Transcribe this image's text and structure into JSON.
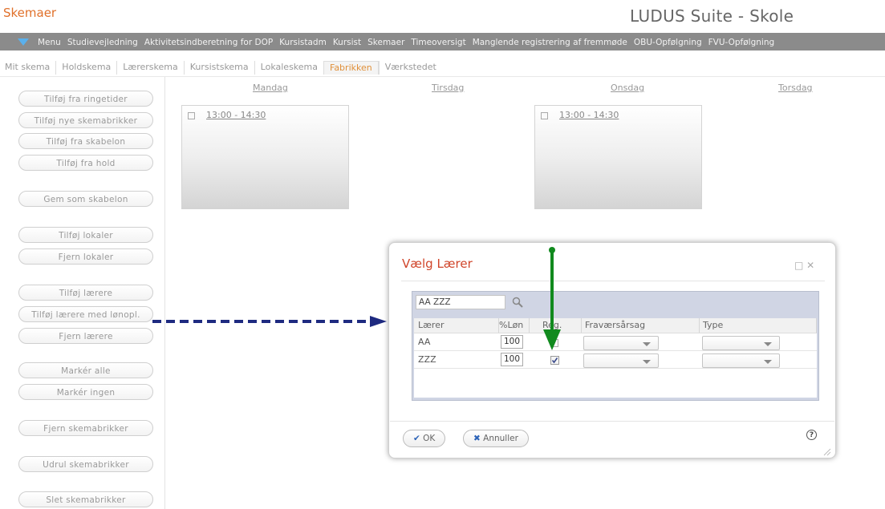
{
  "app": {
    "page_title": "Skemaer",
    "suite_title": "LUDUS Suite - Skole"
  },
  "menu": {
    "items": [
      "Menu",
      "Studievejledning",
      "Aktivitetsindberetning for DOP",
      "Kursistadm",
      "Kursist",
      "Skemaer",
      "Timeoversigt",
      "Manglende registrering af fremmøde",
      "OBU-Opfølgning",
      "FVU-Opfølgning"
    ]
  },
  "tabs": [
    "Mit skema",
    "Holdskema",
    "Lærerskema",
    "Kursistskema",
    "Lokaleskema",
    "Fabrikken",
    "Værkstedet"
  ],
  "active_tab": "Fabrikken",
  "sidebar": {
    "add_from_bell": "Tilføj fra ringetider",
    "add_new_bricks": "Tilføj nye skemabrikker",
    "add_from_template": "Tilføj fra skabelon",
    "add_from_class": "Tilføj fra hold",
    "save_template": "Gem som skabelon",
    "add_rooms": "Tilføj lokaler",
    "remove_rooms": "Fjern lokaler",
    "add_teachers": "Tilføj lærere",
    "add_teachers_pay": "Tilføj lærere med lønopl.",
    "remove_teachers": "Fjern lærere",
    "mark_all": "Markér alle",
    "mark_none": "Markér ingen",
    "remove_bricks": "Fjern skemabrikker",
    "roll_out_bricks": "Udrul skemabrikker",
    "delete_bricks": "Slet skemabrikker"
  },
  "days": {
    "mon": "Mandag",
    "tue": "Tirsdag",
    "wed": "Onsdag",
    "thu": "Torsdag"
  },
  "slots": {
    "mon": "13:00 - 14:30",
    "wed": "13:00 - 14:30"
  },
  "dialog": {
    "title": "Vælg Lærer",
    "search_value": "AA ZZZ",
    "columns": {
      "teacher": "Lærer",
      "pay": "%Løn",
      "reg": "Reg.",
      "absence": "Fraværsårsag",
      "type": "Type"
    },
    "rows": [
      {
        "teacher": "AA",
        "pay": "100",
        "reg": false
      },
      {
        "teacher": "ZZZ",
        "pay": "100",
        "reg": true
      }
    ],
    "ok": "OK",
    "cancel": "Annuller"
  },
  "colors": {
    "accent": "#e0702a",
    "dialog_title": "#d0452a",
    "menubar": "#8b8b8b",
    "annotation_blue": "#1e2a80",
    "annotation_green": "#118a1e"
  }
}
